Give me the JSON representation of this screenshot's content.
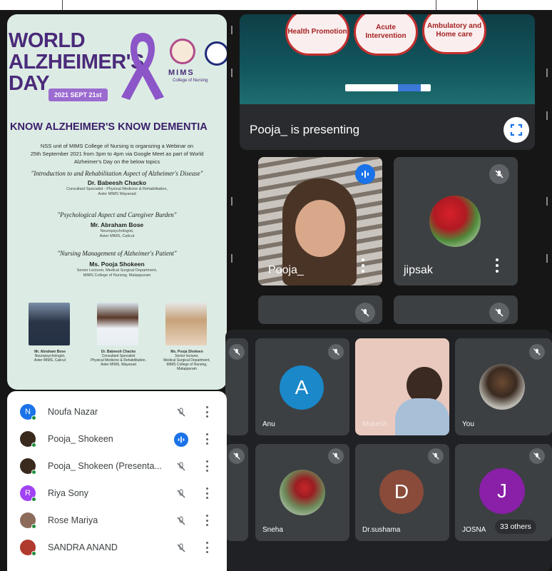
{
  "poster": {
    "title_lines": [
      "WORLD",
      "ALZHEIMER'S",
      "DAY"
    ],
    "date_badge": "2021 SEPT 21st",
    "org_name": "MIMS",
    "org_sub": "College of Nursing",
    "headline": "KNOW ALZHEIMER'S KNOW DEMENTIA",
    "intro": [
      "NSS unit of MIMS College of Nursing is organizing a  Webinar on",
      "25th September 2021 from 3pm to 4pm via Google Meet as part of World",
      "Alzheimer's Day on the below topics"
    ],
    "topics": [
      {
        "title": "\"Introduction to and Rehabilitation Aspect of Alzheimer's Disease\"",
        "speaker": "Dr. Babeesh Chacko",
        "details": [
          "Consultant  Specialist - Physical Medicine & Rehabilitation,",
          "Aster MIMS Wayanad"
        ]
      },
      {
        "title": "\"Psychological Aspect and Caregiver Burden\"",
        "speaker": "Mr. Abraham Bose",
        "details": [
          "Neuropsychologist,",
          "Aster MIMS, Calicut"
        ]
      },
      {
        "title": "\"Nursing Management of Alzheimer's Patient\"",
        "speaker": "Ms. Pooja Shokeen",
        "details": [
          "Senior Lecturer, Medical Surgical Department,",
          "MIMS College of Nursing, Malappuram"
        ]
      }
    ],
    "speaker_cards": [
      {
        "name": "Mr. Abraham Bose",
        "lines": [
          "Neuropsychologist,",
          "Aster MIMS, Calicut"
        ]
      },
      {
        "name": "Dr. Babeesh Chacko",
        "lines": [
          "Consultant Specialist",
          "Physical Medicine & Rehabilitation,",
          "Aster MIMS, Wayanad"
        ]
      },
      {
        "name": "Ms. Pooja Shokeen",
        "lines": [
          "Senior lecturer,",
          "Medical Surgical Department,",
          "MIMS College of Nursing,",
          "Malappuram"
        ]
      }
    ]
  },
  "presentation": {
    "slide_boxes": [
      "Health Promotion",
      "Acute Intervention",
      "Ambulatory and Home care"
    ],
    "presenting_text": "Pooja_ is presenting"
  },
  "tiles_top": [
    {
      "name": "Pooja_",
      "speaking": true
    },
    {
      "name": "jipsak",
      "muted": true
    }
  ],
  "tiles_grid": [
    {
      "name": "Anu",
      "initial": "A",
      "avatar_color": "#1a88c9"
    },
    {
      "name": "Mukesh",
      "video": true
    },
    {
      "name": "You",
      "photo": true
    },
    {
      "name": "Sneha",
      "photo": true
    },
    {
      "name": "Dr.sushama",
      "initial": "D",
      "avatar_color": "#8a4b3a"
    },
    {
      "name": "JOSNA",
      "initial": "J",
      "avatar_color": "#8a1fa8"
    }
  ],
  "others_badge": "33 others",
  "participants": [
    {
      "name": "Noufa Nazar",
      "initial": "N",
      "color": "#1a73e8",
      "state": "muted"
    },
    {
      "name": "Pooja_ Shokeen",
      "initial": "",
      "color": "#3a2a1e",
      "state": "speaking"
    },
    {
      "name": "Pooja_ Shokeen (Presenta...",
      "initial": "",
      "color": "#3a2a1e",
      "state": "muted"
    },
    {
      "name": "Riya Sony",
      "initial": "R",
      "color": "#a142f4",
      "state": "muted"
    },
    {
      "name": "Rose Mariya",
      "initial": "",
      "color": "#8d6b5a",
      "state": "muted"
    },
    {
      "name": "SANDRA ANAND",
      "initial": "",
      "color": "#b03a2e",
      "state": "muted"
    }
  ]
}
